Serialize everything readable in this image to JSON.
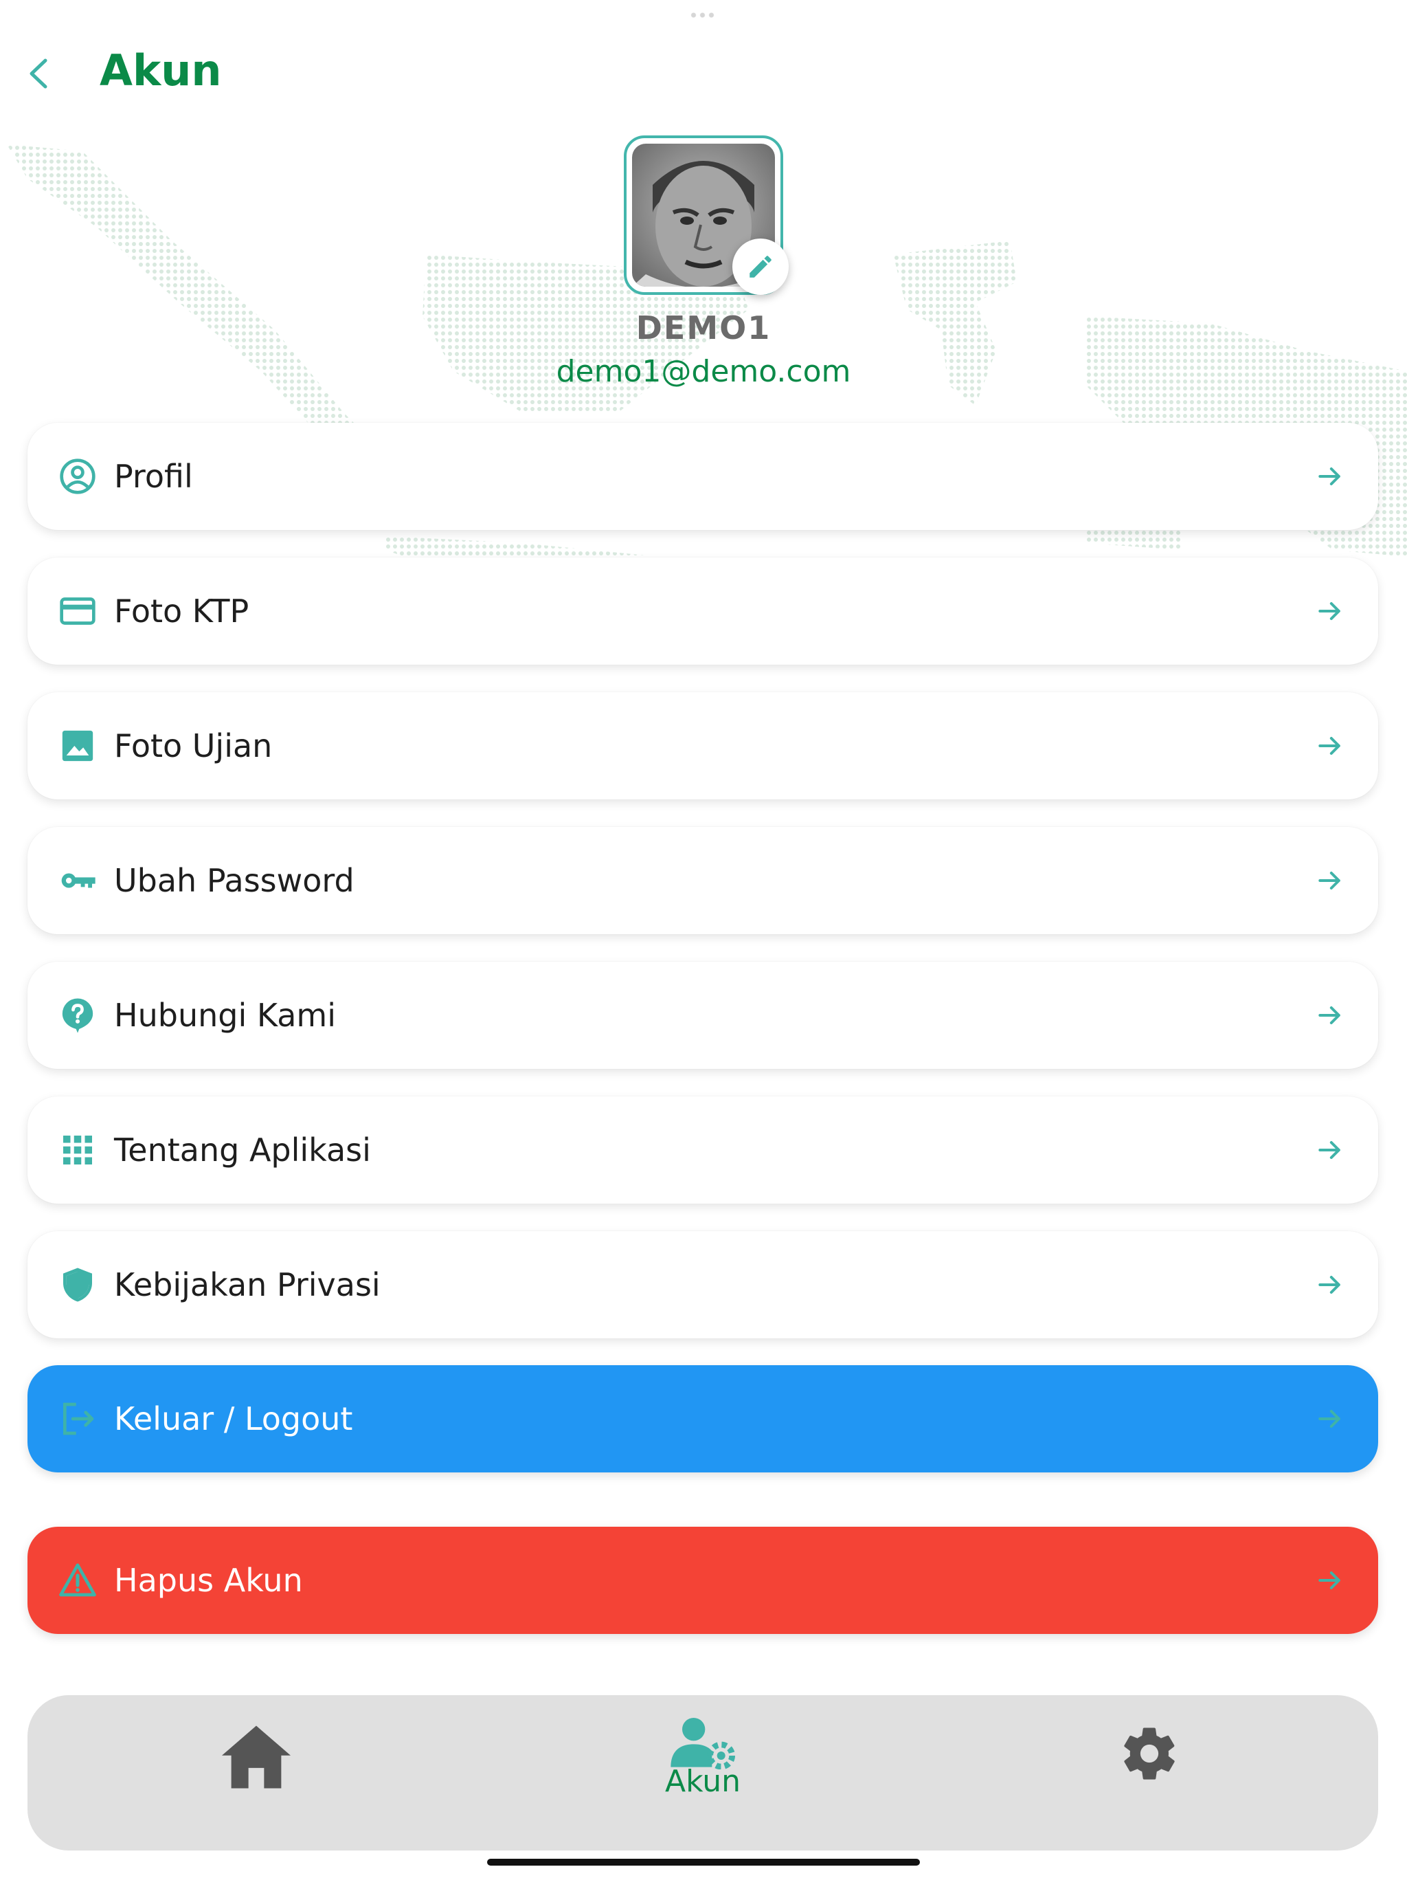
{
  "header": {
    "title": "Akun"
  },
  "profile": {
    "name": "DEMO1",
    "email": "demo1@demo.com"
  },
  "menu": [
    {
      "label": "Profil",
      "icon": "account-circle-icon"
    },
    {
      "label": "Foto KTP",
      "icon": "credit-card-icon"
    },
    {
      "label": "Foto Ujian",
      "icon": "image-icon"
    },
    {
      "label": "Ubah Password",
      "icon": "key-icon"
    },
    {
      "label": "Hubungi Kami",
      "icon": "help-bubble-icon"
    },
    {
      "label": "Tentang Aplikasi",
      "icon": "apps-grid-icon"
    },
    {
      "label": "Kebijakan Privasi",
      "icon": "shield-icon"
    }
  ],
  "actions": {
    "logout": {
      "label": "Keluar / Logout",
      "icon": "logout-icon",
      "color": "#2196f3"
    },
    "delete": {
      "label": "Hapus Akun",
      "icon": "warning-icon",
      "color": "#f44336"
    }
  },
  "bottom_nav": {
    "items": [
      {
        "id": "home",
        "label": "",
        "icon": "home-icon"
      },
      {
        "id": "akun",
        "label": "Akun",
        "icon": "account-settings-icon",
        "active": true
      },
      {
        "id": "settings",
        "label": "",
        "icon": "gear-icon"
      }
    ]
  },
  "colors": {
    "brand_green": "#0b8a48",
    "teal_accent": "#3fb3a8",
    "logout_blue": "#2196f3",
    "danger_red": "#f44336",
    "nav_bg": "#e0e0e0"
  }
}
